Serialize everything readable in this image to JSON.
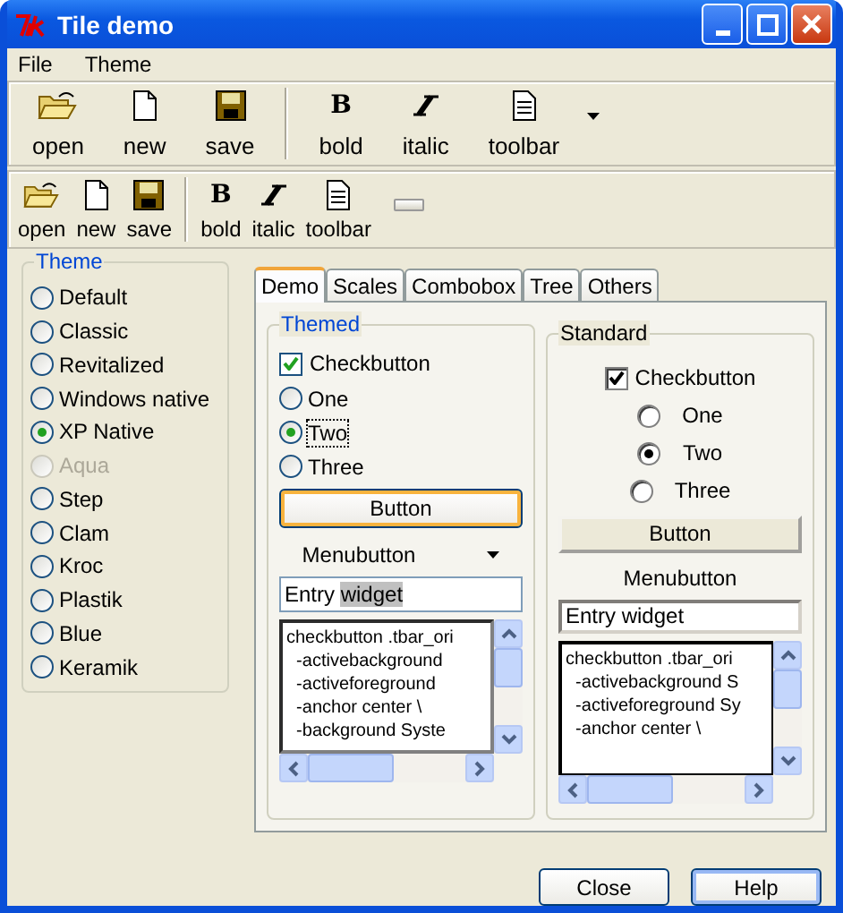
{
  "window": {
    "title": "Tile demo"
  },
  "menu": [
    {
      "label": "File"
    },
    {
      "label": "Theme"
    }
  ],
  "toolbars": [
    {
      "items": [
        {
          "kind": "open",
          "label": "open"
        },
        {
          "kind": "new",
          "label": "new"
        },
        {
          "kind": "save",
          "label": "save"
        },
        {
          "kind": "separator"
        },
        {
          "kind": "bold",
          "label": "bold",
          "glyph": "B"
        },
        {
          "kind": "italic",
          "label": "italic"
        },
        {
          "kind": "doc",
          "label": "toolbar"
        }
      ]
    },
    {
      "items": [
        {
          "kind": "open",
          "label": "open"
        },
        {
          "kind": "new",
          "label": "new"
        },
        {
          "kind": "save",
          "label": "save"
        },
        {
          "kind": "separator"
        },
        {
          "kind": "bold",
          "label": "bold",
          "glyph": "B"
        },
        {
          "kind": "italic",
          "label": "italic"
        },
        {
          "kind": "doc",
          "label": "toolbar"
        }
      ]
    }
  ],
  "theme_group": {
    "title": "Theme",
    "options": [
      {
        "label": "Default",
        "selected": false,
        "disabled": false
      },
      {
        "label": "Classic",
        "selected": false,
        "disabled": false
      },
      {
        "label": "Revitalized",
        "selected": false,
        "disabled": false
      },
      {
        "label": "Windows native",
        "selected": false,
        "disabled": false
      },
      {
        "label": "XP Native",
        "selected": true,
        "disabled": false
      },
      {
        "label": "Aqua",
        "selected": false,
        "disabled": true
      },
      {
        "label": "Step",
        "selected": false,
        "disabled": false
      },
      {
        "label": "Clam",
        "selected": false,
        "disabled": false
      },
      {
        "label": "Kroc",
        "selected": false,
        "disabled": false
      },
      {
        "label": "Plastik",
        "selected": false,
        "disabled": false
      },
      {
        "label": "Blue",
        "selected": false,
        "disabled": false
      },
      {
        "label": "Keramik",
        "selected": false,
        "disabled": false
      }
    ]
  },
  "tabs": [
    {
      "label": "Demo",
      "selected": true
    },
    {
      "label": "Scales",
      "selected": false
    },
    {
      "label": "Combobox",
      "selected": false
    },
    {
      "label": "Tree",
      "selected": false
    },
    {
      "label": "Others",
      "selected": false
    }
  ],
  "panels": [
    {
      "title": "Themed",
      "check": {
        "label": "Checkbutton",
        "checked": true
      },
      "radios": [
        {
          "label": "One",
          "selected": false
        },
        {
          "label": "Two",
          "selected": true
        },
        {
          "label": "Three",
          "selected": false
        }
      ],
      "button": "Button",
      "menubutton": "Menubutton",
      "entry": {
        "value": "Entry ",
        "selected_text": "widget"
      },
      "listing": [
        "checkbutton .tbar_ori",
        "  -activebackground",
        "  -activeforeground",
        "  -anchor center \\",
        "  -background Syste"
      ]
    },
    {
      "title": "Standard",
      "check": {
        "label": "Checkbutton",
        "checked": true
      },
      "radios": [
        {
          "label": "One",
          "selected": false
        },
        {
          "label": "Two",
          "selected": true
        },
        {
          "label": "Three",
          "selected": false
        }
      ],
      "button": "Button",
      "menubutton": "Menubutton",
      "entry": {
        "value": "Entry widget"
      },
      "listing": [
        "checkbutton .tbar_ori",
        "  -activebackground S",
        "  -activeforeground Sy",
        "  -anchor center \\"
      ]
    }
  ],
  "buttons": [
    {
      "label": "Close",
      "default": false
    },
    {
      "label": "Help",
      "default": true
    }
  ]
}
